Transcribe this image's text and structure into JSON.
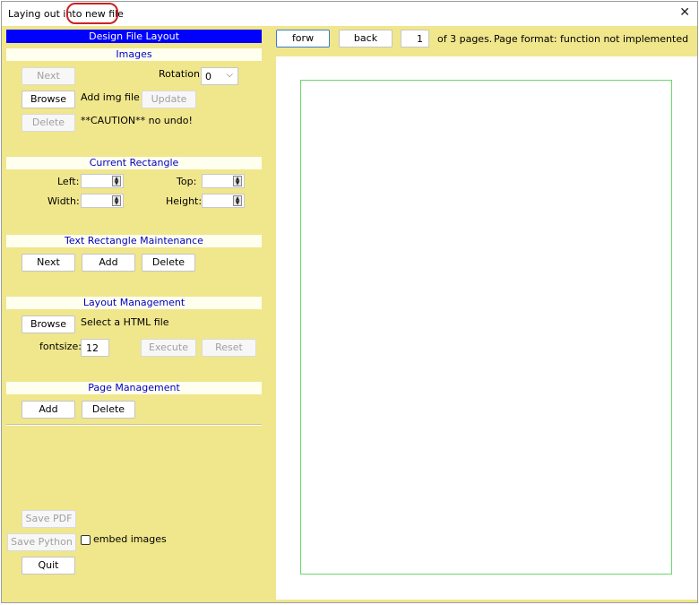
{
  "window": {
    "title": "Laying out into new file",
    "close_icon": "close-icon",
    "highlight_color": "#cc2222",
    "background_color": "#f0e68c"
  },
  "left_panel": {
    "header": "Design File Layout",
    "images": {
      "title": "Images",
      "next_label": "Next",
      "rotation_label": "Rotation:",
      "rotation_value": "0",
      "browse_label": "Browse",
      "add_img_label": "Add img file",
      "update_label": "Update",
      "delete_label": "Delete",
      "caution_text": "**CAUTION** no undo!"
    },
    "current_rectangle": {
      "title": "Current Rectangle",
      "left_label": "Left:",
      "top_label": "Top:",
      "width_label": "Width:",
      "height_label": "Height:"
    },
    "text_rect": {
      "title": "Text Rectangle Maintenance",
      "next_label": "Next",
      "add_label": "Add",
      "delete_label": "Delete"
    },
    "layout_mgmt": {
      "title": "Layout Management",
      "browse_label": "Browse",
      "select_html_label": "Select a HTML file",
      "fontsize_label": "fontsize:",
      "fontsize_value": "12",
      "execute_label": "Execute",
      "reset_label": "Reset"
    },
    "page_mgmt": {
      "title": "Page Management",
      "add_label": "Add",
      "delete_label": "Delete"
    },
    "footer": {
      "save_pdf_label": "Save PDF",
      "save_python_label": "Save Python",
      "embed_images_label": "embed images",
      "embed_images_checked": false,
      "quit_label": "Quit"
    }
  },
  "toolbar": {
    "forw_label": "forw",
    "back_label": "back",
    "page_number": "1",
    "of_pages_text": "of 3 pages.",
    "page_format_text": "Page format: function not implemented"
  },
  "canvas": {
    "rect_color": "#6ad86a"
  }
}
